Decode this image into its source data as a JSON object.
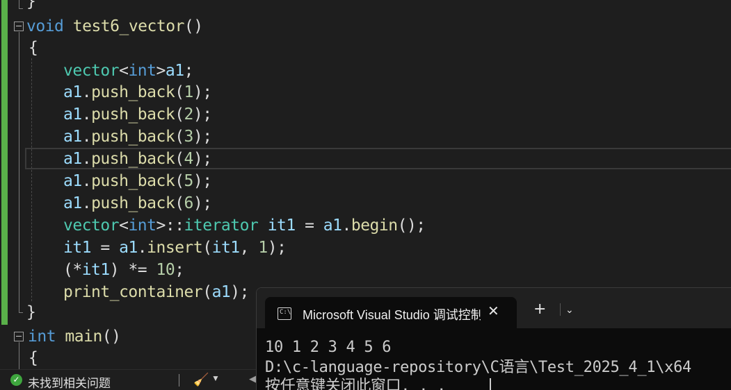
{
  "editor": {
    "lines": {
      "l0": "}",
      "l1_kw": "void",
      "l1_fn": "test6_vector",
      "l1_pun": "()",
      "l2": "{",
      "l3_ty": "vector",
      "l3_pun1": "<",
      "l3_kw": "int",
      "l3_pun2": ">",
      "l3_var": "a1",
      "l3_end": ";",
      "pb": [
        {
          "var": "a1",
          "fn": "push_back",
          "num": "1"
        },
        {
          "var": "a1",
          "fn": "push_back",
          "num": "2"
        },
        {
          "var": "a1",
          "fn": "push_back",
          "num": "3"
        },
        {
          "var": "a1",
          "fn": "push_back",
          "num": "4"
        },
        {
          "var": "a1",
          "fn": "push_back",
          "num": "5"
        },
        {
          "var": "a1",
          "fn": "push_back",
          "num": "6"
        }
      ],
      "l10_ty": "vector",
      "l10_kw": "int",
      "l10_ty2": "iterator",
      "l10_var": "it1",
      "l10_var2": "a1",
      "l10_fn": "begin",
      "l11_var": "it1",
      "l11_var2": "a1",
      "l11_fn": "insert",
      "l11_var3": "it1",
      "l11_num": "1",
      "l12_var": "it1",
      "l12_num": "10",
      "l13_fn": "print_container",
      "l13_var": "a1",
      "l14": "}",
      "l15_kw": "int",
      "l15_fn": "main",
      "l15_pun": "()",
      "l16": "{"
    }
  },
  "statusbar": {
    "issues_text": "未找到相关问题",
    "ok_icon": "check-circle-icon",
    "cleanup_icon": "broom-icon"
  },
  "terminal": {
    "tab_title": "Microsoft Visual Studio 调试控制台",
    "close_glyph": "✕",
    "new_tab_glyph": "+",
    "dropdown_glyph": "⌄",
    "output": [
      "10 1 2 3 4 5 6",
      "D:\\c-language-repository\\C语言\\Test_2025_4_1\\x64",
      "按任意键关闭此窗口. . ."
    ]
  },
  "colors": {
    "keyword": "#569cd6",
    "type": "#4ec9b0",
    "function": "#dcdcaa",
    "variable": "#9cdcfe",
    "number": "#b5cea8",
    "change_bar": "#5ab04a"
  }
}
